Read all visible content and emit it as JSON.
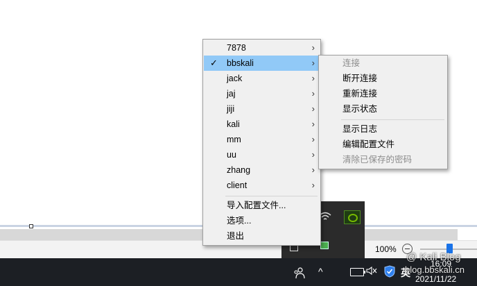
{
  "menu": {
    "connections": [
      {
        "label": "7878"
      },
      {
        "label": "bbskali",
        "checked": true,
        "selected": true
      },
      {
        "label": "jack"
      },
      {
        "label": "jaj"
      },
      {
        "label": "jiji"
      },
      {
        "label": "kali"
      },
      {
        "label": "mm"
      },
      {
        "label": "uu"
      },
      {
        "label": "zhang"
      },
      {
        "label": "client"
      }
    ],
    "actions": {
      "import": "导入配置文件...",
      "options": "选项...",
      "exit": "退出"
    },
    "arrow_glyph": "›",
    "check_glyph": "✓"
  },
  "submenu": {
    "connect": "连接",
    "disconnect": "断开连接",
    "reconnect": "重新连接",
    "show_status": "显示状态",
    "show_log": "显示日志",
    "edit_config": "编辑配置文件",
    "clear_saved_password": "清除已保存的密码"
  },
  "statusbar": {
    "zoom": "100%"
  },
  "taskbar": {
    "time": "16:09",
    "date": "2021/11/22",
    "ime": "英",
    "chevron": "^"
  },
  "watermark": {
    "line1": "@ Kali Blog",
    "line2": "blog.bbskali.cn"
  },
  "colors": {
    "menu_bg": "#f0f0f0",
    "menu_selected": "#91c9f7",
    "taskbar": "#1c1f24",
    "disabled_text": "#8c8c8c"
  }
}
